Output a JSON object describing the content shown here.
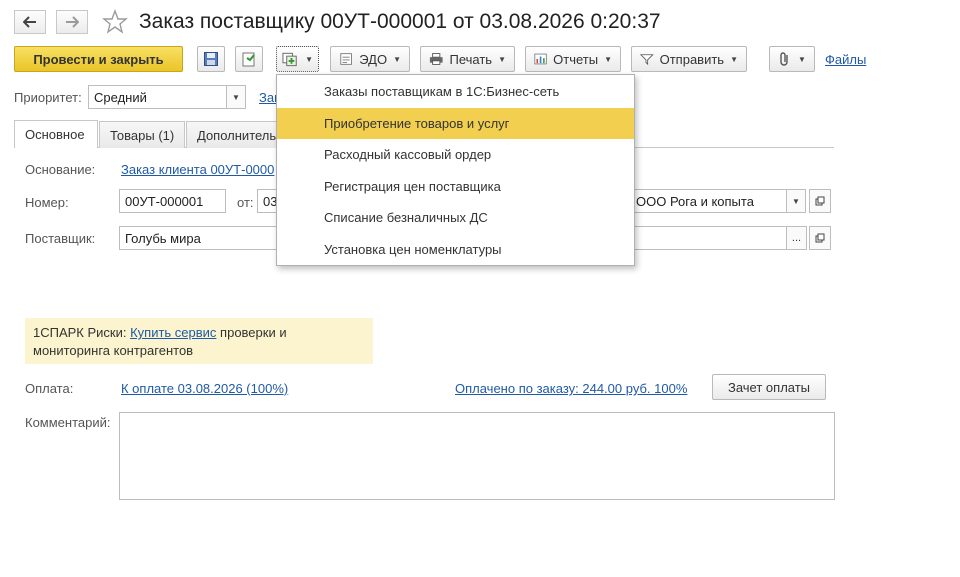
{
  "window": {
    "title": "Заказ поставщику 00УТ-000001 от 03.08.2026 0:20:37"
  },
  "toolbar": {
    "post_close": "Провести и закрыть",
    "edo": "ЭДО",
    "print": "Печать",
    "reports": "Отчеты",
    "send": "Отправить",
    "files": "Файлы"
  },
  "priority": {
    "label": "Приоритет:",
    "value": "Средний",
    "link_partial": "Зак"
  },
  "tabs": [
    {
      "label": "Основное"
    },
    {
      "label": "Товары (1)"
    },
    {
      "label": "Дополнитель"
    }
  ],
  "form": {
    "basis_label": "Основание:",
    "basis_link": "Заказ клиента 00УТ-0000",
    "number_label": "Номер:",
    "number_value": "00УТ-000001",
    "from_label": "от:",
    "date_partial": "03",
    "org_value": "ООО Рога и копыта",
    "supplier_label": "Поставщик:",
    "supplier_value": "Голубь мира",
    "ellipsis": "...",
    "spark_prefix": "1СПАРК Риски: ",
    "spark_link": "Купить сервис",
    "spark_suffix": " проверки и",
    "spark_line2": "мониторинга контрагентов",
    "payment_label": "Оплата:",
    "payment_link": "К оплате 03.08.2026 (100%)",
    "paid_link": "Оплачено по заказу: 244.00 руб. 100%",
    "offset_button": "Зачет оплаты",
    "comment_label": "Комментарий:",
    "comment_value": ""
  },
  "dropdown_menu": {
    "items": [
      {
        "label": "Заказы поставщикам в 1С:Бизнес-сеть"
      },
      {
        "label": "Приобретение товаров и услуг"
      },
      {
        "label": "Расходный кассовый ордер"
      },
      {
        "label": "Регистрация цен поставщика"
      },
      {
        "label": "Списание безналичных ДС"
      },
      {
        "label": "Установка цен номенклатуры"
      }
    ],
    "active_index": 1,
    "highlight_color": "#f2cf4e"
  },
  "colors": {
    "primary_button": "#f0d244",
    "link": "#1f5aa8",
    "notice_bg": "#fbf4cf"
  },
  "icons": [
    "back-arrow-icon",
    "forward-arrow-icon",
    "star-icon",
    "save-icon",
    "document-structure-icon",
    "create-based-on-icon",
    "edo-icon",
    "printer-icon",
    "reports-icon",
    "send-icon",
    "paperclip-icon",
    "open-icon"
  ]
}
